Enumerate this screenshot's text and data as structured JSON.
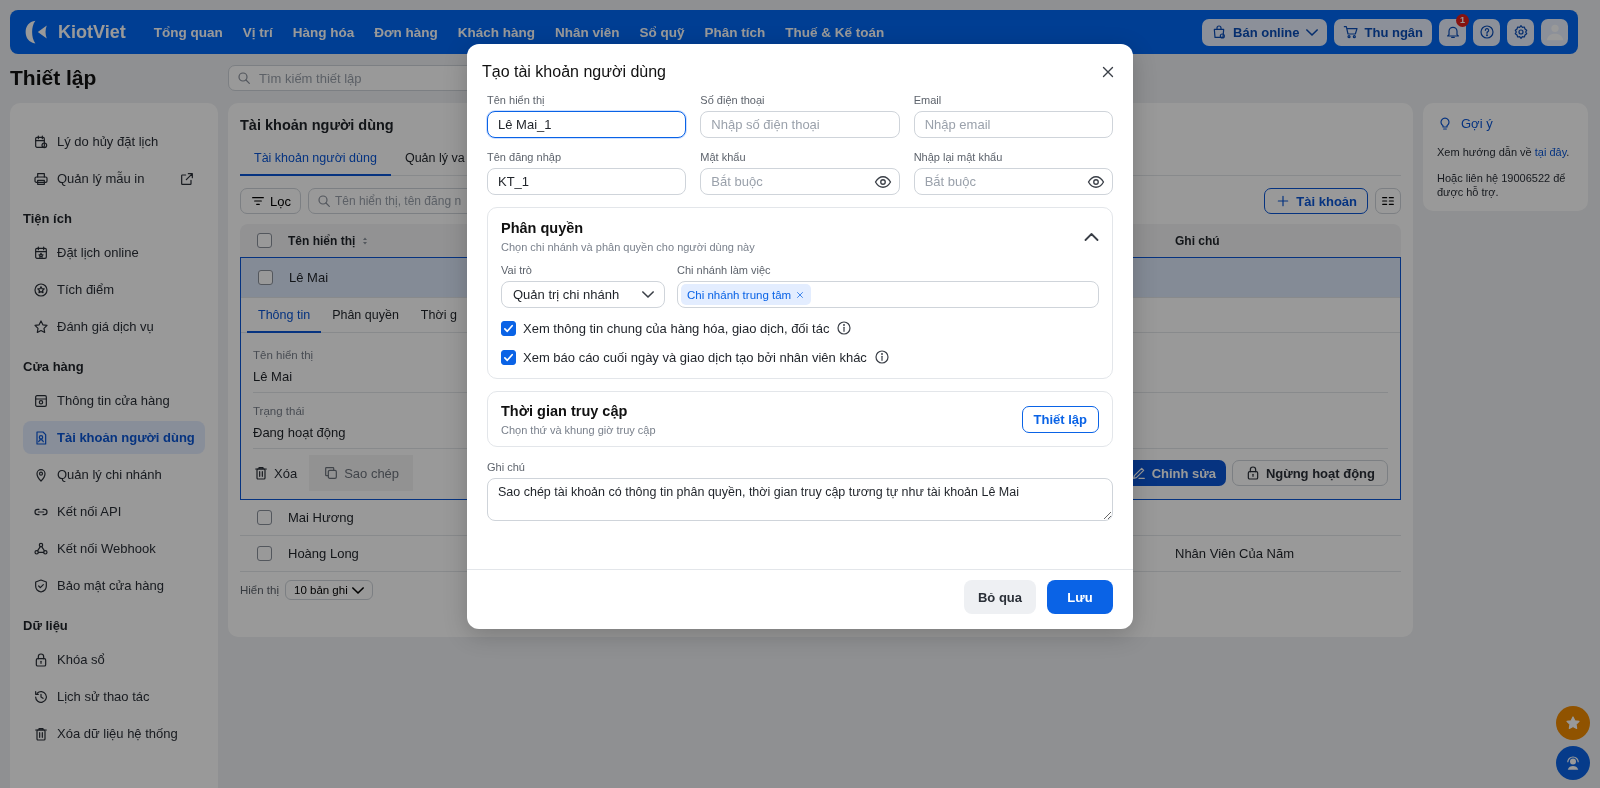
{
  "nav": {
    "logo": "KiotViet",
    "items": [
      "Tổng quan",
      "Vị trí",
      "Hàng hóa",
      "Đơn hàng",
      "Khách hàng",
      "Nhân viên",
      "Sổ quỹ",
      "Phân tích",
      "Thuế & Kế toán"
    ],
    "buttons": [
      {
        "kind": "online",
        "label": "Bán online"
      },
      {
        "kind": "cashier",
        "label": "Thu ngân"
      }
    ],
    "notification_count": "1"
  },
  "page": {
    "title": "Thiết lập",
    "search_placeholder": "Tìm kiếm thiết lập"
  },
  "sidebar": {
    "sections": [
      {
        "items": [
          {
            "label": "Lý do hủy đặt lịch",
            "selected": false,
            "external": false
          },
          {
            "label": "Quản lý mẫu in",
            "selected": false,
            "external": true
          }
        ]
      },
      {
        "title": "Tiện ích",
        "items": [
          {
            "label": "Đặt lịch online",
            "selected": false,
            "external": false
          },
          {
            "label": "Tích điểm",
            "selected": false,
            "external": false
          },
          {
            "label": "Đánh giá dịch vụ",
            "selected": false,
            "external": false
          }
        ]
      },
      {
        "title": "Cửa hàng",
        "items": [
          {
            "label": "Thông tin cửa hàng",
            "selected": false,
            "external": false
          },
          {
            "label": "Tài khoản người dùng",
            "selected": true,
            "external": false
          },
          {
            "label": "Quản lý chi nhánh",
            "selected": false,
            "external": false
          },
          {
            "label": "Kết nối API",
            "selected": false,
            "external": false
          },
          {
            "label": "Kết nối Webhook",
            "selected": false,
            "external": false
          },
          {
            "label": "Bảo mật cửa hàng",
            "selected": false,
            "external": false
          }
        ]
      },
      {
        "title": "Dữ liệu",
        "items": [
          {
            "label": "Khóa sổ",
            "selected": false,
            "external": false
          },
          {
            "label": "Lịch sử thao tác",
            "selected": false,
            "external": false
          },
          {
            "label": "Xóa dữ liệu hệ thống",
            "selected": false,
            "external": false
          }
        ]
      }
    ]
  },
  "main": {
    "title": "Tài khoản người dùng",
    "tabs": [
      {
        "label": "Tài khoản người dùng",
        "selected": true
      },
      {
        "label": "Quản lý va",
        "selected": false
      }
    ],
    "filter_button": "Lọc",
    "search_placeholder": "Tên hiển thị, tên đăng n",
    "add_button": "Tài khoản",
    "table": {
      "columns": [
        "Tên hiển thị",
        "Ghi chú"
      ],
      "all_checked": false,
      "rows": [
        {
          "name": "Lê Mai",
          "checked": false,
          "expanded": true
        },
        {
          "name": "Mai Hương",
          "checked": false,
          "expanded": false
        },
        {
          "name": "Hoàng Long",
          "note": "Nhân Viên Của Năm",
          "checked": false,
          "expanded": false
        }
      ]
    },
    "detail": {
      "tabs": [
        {
          "label": "Thông tin",
          "selected": true
        },
        {
          "label": "Phân quyền",
          "selected": false
        },
        {
          "label": "Thời g",
          "selected": false
        }
      ],
      "fields": [
        {
          "label": "Tên hiển thị",
          "value": "Lê Mai"
        },
        {
          "label": "Trạng thái",
          "value": "Đang hoạt động"
        }
      ],
      "actions": [
        {
          "kind": "delete",
          "label": "Xóa",
          "highlighted": false
        },
        {
          "kind": "copy",
          "label": "Sao chép",
          "highlighted": true
        },
        {
          "kind": "edit",
          "label": "Chỉnh sửa",
          "highlighted": false
        },
        {
          "kind": "lock",
          "label": "Ngừng hoạt động",
          "highlighted": false
        }
      ]
    },
    "footer": {
      "label": "Hiển thị",
      "page_size": "10 bản ghi"
    }
  },
  "hint": {
    "title": "Gợi ý",
    "text_before": "Xem hướng dẫn về ",
    "link": "tại đây",
    "text_after": ".",
    "contact": "Hoặc liên hệ 19006522 để được hỗ trợ."
  },
  "modal": {
    "title": "Tạo tài khoản người dùng",
    "fields": [
      {
        "label": "Tên hiển thị",
        "value": "Lê Mai_1",
        "focused": true
      },
      {
        "label": "Số điện thoại",
        "placeholder": "Nhập số điện thoại",
        "focused": false
      },
      {
        "label": "Email",
        "placeholder": "Nhập email",
        "focused": false
      },
      {
        "label": "Tên đăng nhập",
        "value": "KT_1",
        "focused": false
      },
      {
        "label": "Mật khẩu",
        "placeholder": "Bắt buộc",
        "kind": "password",
        "focused": false
      },
      {
        "label": "Nhập lại mật khẩu",
        "placeholder": "Bắt buộc",
        "kind": "password",
        "focused": false
      }
    ],
    "permission": {
      "title": "Phân quyền",
      "subtitle": "Chọn chi nhánh và phân quyền cho người dùng này",
      "expanded": true,
      "role_label": "Vai trò",
      "role_value": "Quản trị chi nhánh",
      "branch_label": "Chi nhánh làm việc",
      "branches": [
        "Chi nhánh trung tâm"
      ],
      "options": [
        {
          "label": "Xem thông tin chung của hàng hóa, giao dịch, đối tác",
          "checked": true
        },
        {
          "label": "Xem báo cáo cuối ngày và giao dịch tạo bởi nhân viên khác",
          "checked": true
        }
      ]
    },
    "access": {
      "title": "Thời gian truy cập",
      "subtitle": "Chọn thứ và khung giờ truy cập",
      "button": "Thiết lập"
    },
    "note_label": "Ghi chú",
    "note_value": "Sao chép tài khoản có thông tin phân quyền, thời gian truy cập tương tự như tài khoản Lê Mai",
    "buttons": [
      {
        "kind": "cancel",
        "label": "Bỏ qua"
      },
      {
        "kind": "save",
        "label": "Lưu"
      }
    ]
  }
}
